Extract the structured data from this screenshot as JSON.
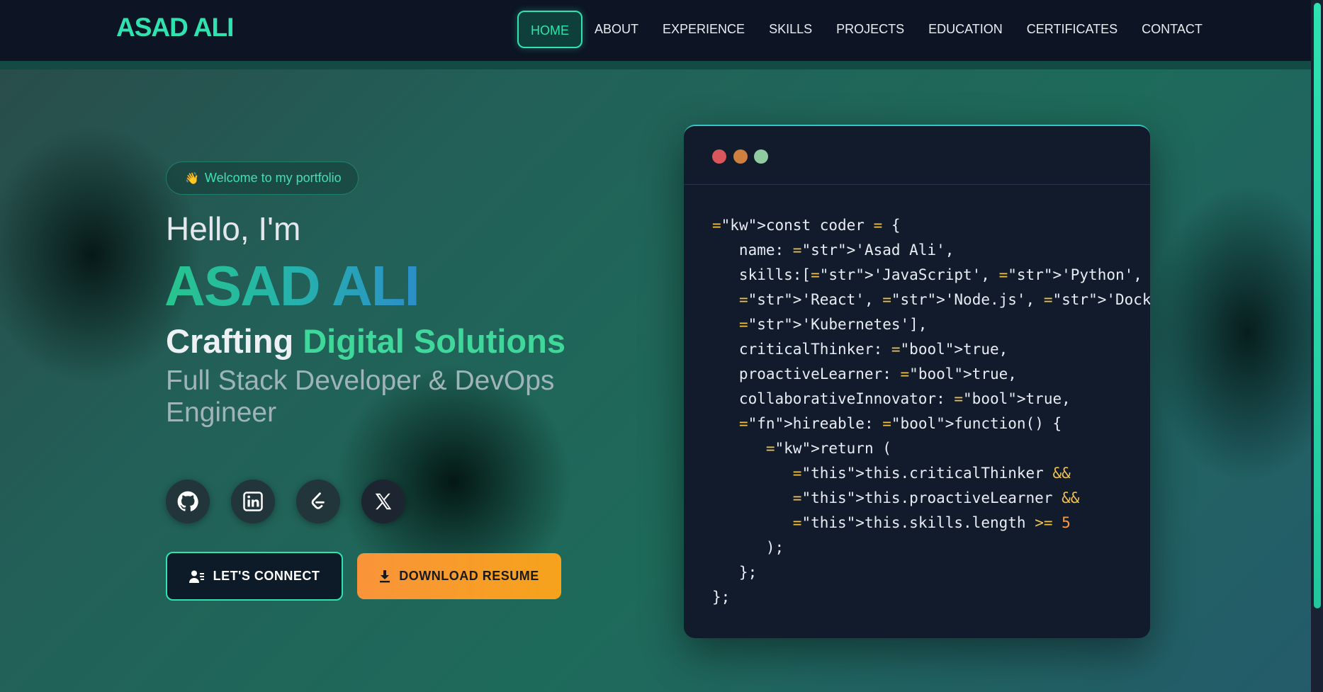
{
  "header": {
    "logo": "ASAD ALI",
    "nav": [
      "HOME",
      "ABOUT",
      "EXPERIENCE",
      "SKILLS",
      "PROJECTS",
      "EDUCATION",
      "CERTIFICATES",
      "CONTACT"
    ],
    "active_nav": "HOME"
  },
  "hero": {
    "badge_emoji": "👋",
    "badge_text": "Welcome to my portfolio",
    "greeting": "Hello, I'm",
    "name": "ASAD ALI",
    "tagline_part1": "Crafting",
    "tagline_part2": "Digital Solutions",
    "role": "Full Stack Developer & DevOps Engineer",
    "socials": [
      "github-icon",
      "linkedin-icon",
      "leetcode-icon",
      "x-icon"
    ],
    "connect_label": "LET'S CONNECT",
    "resume_label": "DOWNLOAD RESUME"
  },
  "code": {
    "lines": [
      "const coder = {",
      "   name: 'Asad Ali',",
      "   skills:['JavaScript', 'Python', 'Java',",
      "   'React', 'Node.js', 'Docker', 'AWS',",
      "   'Kubernetes'],",
      "   criticalThinker: true,",
      "   proactiveLearner: true,",
      "   collaborativeInnovator: true,",
      "   hireable: function() {",
      "      return (",
      "         this.criticalThinker &&",
      "         this.proactiveLearner &&",
      "         this.skills.length >= 5",
      "      );",
      "   };",
      "};"
    ]
  },
  "colors": {
    "accent": "#2fe3b0",
    "navbar_bg": "#0d1424",
    "resume_button": "#f6a31b"
  }
}
